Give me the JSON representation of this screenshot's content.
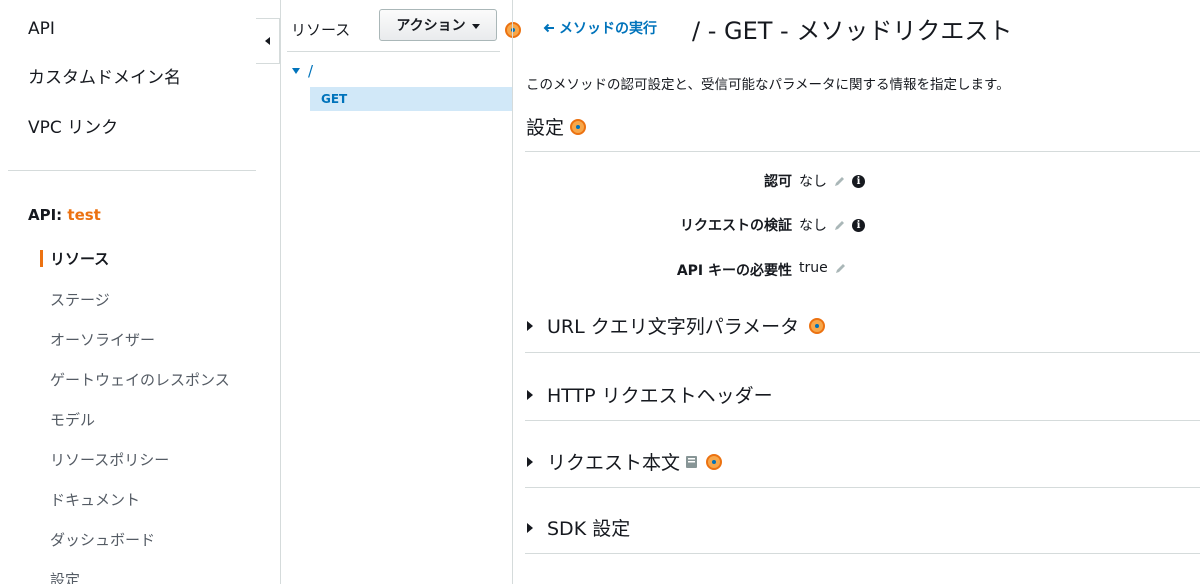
{
  "nav": {
    "top_items": [
      "API",
      "カスタムドメイン名",
      "VPC リンク"
    ],
    "api_prefix": "API: ",
    "api_name": "test",
    "items": [
      "リソース",
      "ステージ",
      "オーソライザー",
      "ゲートウェイのレスポンス",
      "モデル",
      "リソースポリシー",
      "ドキュメント",
      "ダッシュボード",
      "設定"
    ],
    "active_item": "リソース"
  },
  "resources": {
    "header": "リソース",
    "action_button": "アクション",
    "root_path": "/",
    "selected_method": "GET"
  },
  "main": {
    "back_link": "メソッドの実行",
    "title": "/ - GET - メソッドリクエスト",
    "description": "このメソッドの認可設定と、受信可能なパラメータに関する情報を指定します。",
    "settings_title": "設定",
    "settings": [
      {
        "label": "認可",
        "value": "なし"
      },
      {
        "label": "リクエストの検証",
        "value": "なし"
      },
      {
        "label": "API キーの必要性",
        "value": "true"
      }
    ],
    "sections": [
      "URL クエリ文字列パラメータ",
      "HTTP リクエストヘッダー",
      "リクエスト本文",
      "SDK 設定"
    ]
  },
  "colors": {
    "accent": "#ec7211",
    "link": "#0073bb",
    "selected_bg": "#d1e8f8"
  }
}
